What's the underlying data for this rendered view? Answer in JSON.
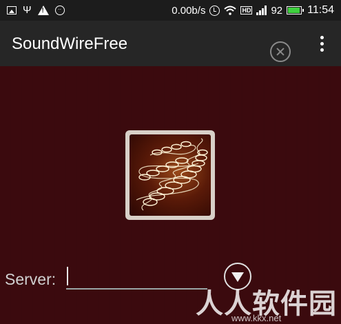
{
  "status_bar": {
    "left_icons": [
      "image-icon",
      "usb-icon",
      "warning-icon",
      "emoji-icon"
    ],
    "net_speed": "0.00b/s",
    "hd_label": "HD",
    "battery_level": "92",
    "battery_color": "#3fd13f",
    "time": "11:54"
  },
  "action_bar": {
    "title": "SoundWireFree",
    "icons": [
      "close-circle-icon",
      "overflow-menu-icon"
    ]
  },
  "main": {
    "logo": "spring-coil-logo",
    "server_label": "Server:",
    "server_value": "",
    "dropdown_icon": "dropdown-arrow-icon"
  },
  "watermark": {
    "text": "人人软件园",
    "url": "www.kkx.net"
  },
  "colors": {
    "background": "#3a0a0d",
    "action_bar": "#262626",
    "status_bar": "#1c1c1c"
  }
}
